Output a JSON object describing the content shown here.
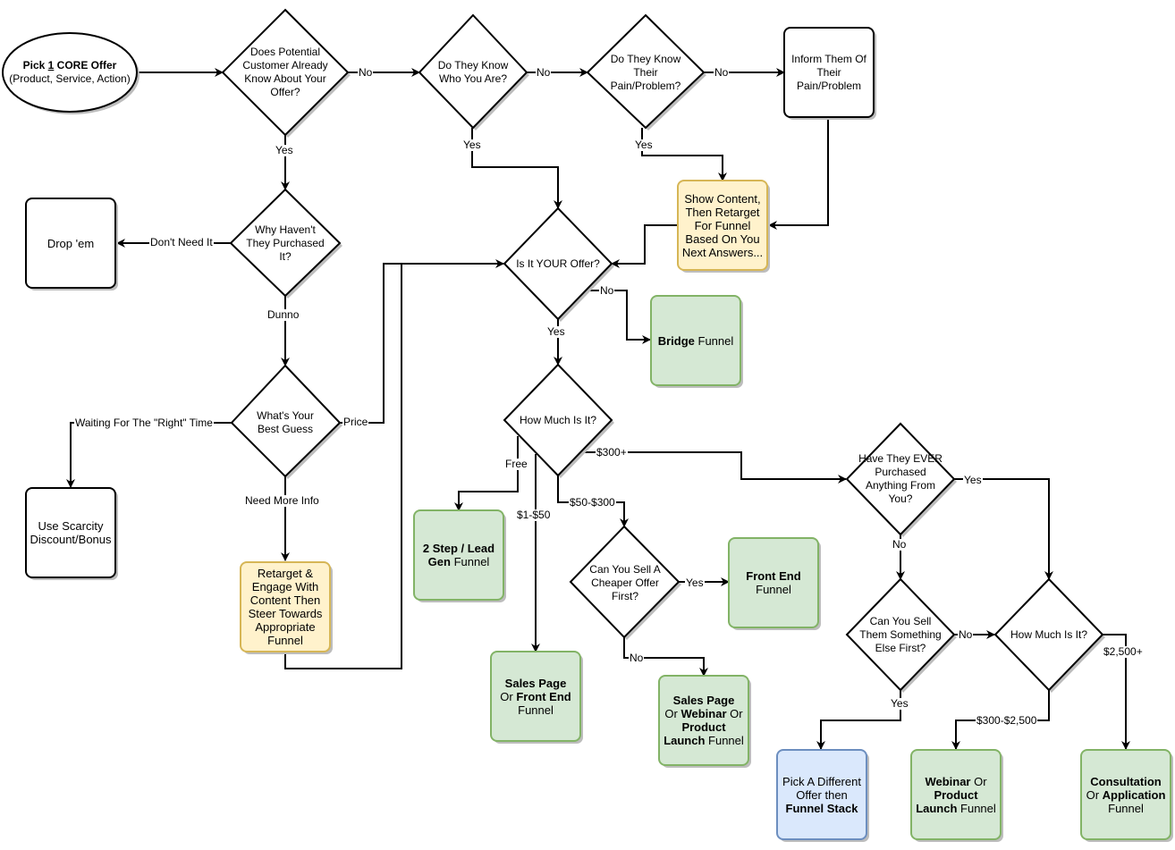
{
  "diagram": {
    "nodes": {
      "start": {
        "line1_pre": "Pick ",
        "line1_num": "1",
        "line1_post": " CORE Offer",
        "line2": "(Product, Service, Action)"
      },
      "know_offer": {
        "label": "Does Potential Customer Already Know About Your Offer?"
      },
      "know_you": {
        "label": "Do They Know Who You Are?"
      },
      "know_pain": {
        "label": "Do They Know Their Pain/Problem?"
      },
      "inform_pain": {
        "label": "Inform Them Of Their Pain/Problem"
      },
      "why_not": {
        "label": "Why Haven't They Purchased It?"
      },
      "drop": {
        "label": "Drop 'em"
      },
      "show_content": {
        "label": "Show Content, Then Retarget For Funnel Based On You Next Answers..."
      },
      "your_offer": {
        "label": "Is It YOUR Offer?"
      },
      "bridge": {
        "bold": "Bridge",
        "rest": " Funnel"
      },
      "best_guess": {
        "label": "What's Your Best Guess"
      },
      "scarcity": {
        "label": "Use Scarcity Discount/Bonus"
      },
      "retarget": {
        "label": "Retarget & Engage With Content Then Steer Towards Appropriate Funnel"
      },
      "how_much": {
        "label": "How Much Is It?"
      },
      "two_step": {
        "bold": "2 Step / Lead Gen",
        "rest": " Funnel"
      },
      "sales_page": {
        "bold1": "Sales Page",
        "mid": "Or ",
        "bold2": "Front End",
        "rest": "Funnel"
      },
      "cheaper": {
        "label": "Can You Sell A Cheaper Offer First?"
      },
      "front_end": {
        "bold": "Front End",
        "rest": "Funnel"
      },
      "sales_webinar": {
        "bold1": "Sales Page",
        "or1": "Or ",
        "bold2": "Webinar",
        "or2": " Or",
        "bold3": "Product",
        "bold4": "Launch",
        "rest": " Funnel"
      },
      "ever_purchased": {
        "label": "Have They EVER Purchased Anything From You?"
      },
      "sell_else": {
        "label": "Can You Sell Them Something Else First?"
      },
      "how_much_2": {
        "label": "How Much Is It?"
      },
      "different_offer": {
        "line1": "Pick A Different",
        "line2": "Offer then",
        "bold": "Funnel Stack"
      },
      "webinar_launch": {
        "bold1": "Webinar",
        "or": " Or",
        "bold2": "Product",
        "bold3": "Launch",
        "rest": " Funnel"
      },
      "consultation": {
        "bold1": "Consultation",
        "or": "Or ",
        "bold2": "Application",
        "rest": "Funnel"
      }
    },
    "edge_labels": {
      "offer_no": "No",
      "offer_yes": "Yes",
      "you_no": "No",
      "you_yes": "Yes",
      "pain_no": "No",
      "pain_yes": "Yes",
      "dont_need": "Don't Need It",
      "dunno": "Dunno",
      "your_no": "No",
      "your_yes": "Yes",
      "waiting": "Waiting For The \"Right\" Time",
      "price": "Price",
      "need_info": "Need More Info",
      "free": "Free",
      "one_fifty": "$1-$50",
      "fifty_300": "$50-$300",
      "three_hundred_plus": "$300+",
      "cheaper_yes": "Yes",
      "cheaper_no": "No",
      "ever_yes": "Yes",
      "ever_no": "No",
      "else_no": "No",
      "else_yes": "Yes",
      "range_300_2500": "$300-$2,500",
      "range_2500_plus": "$2,500+"
    },
    "colors": {
      "decision_fill": "#ffffff",
      "content_fill": "#fff2cc",
      "content_stroke": "#d6b656",
      "funnel_fill": "#d5e8d4",
      "funnel_stroke": "#82b366",
      "alt_fill": "#dae8fc",
      "alt_stroke": "#6c8ebf"
    }
  }
}
